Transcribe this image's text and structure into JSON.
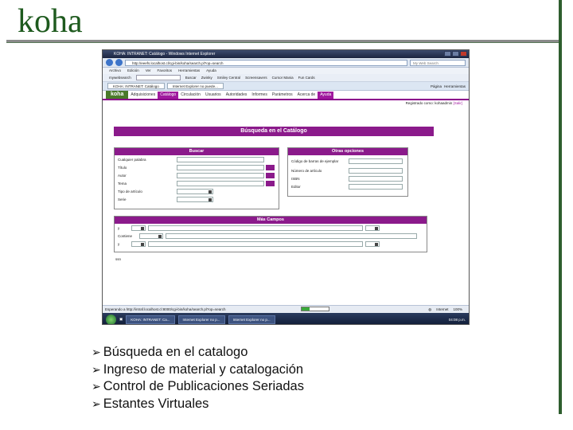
{
  "slide": {
    "title": "koha",
    "bullets": [
      "Búsqueda en el catalogo",
      "Ingreso de material y catalogación",
      "Control de Publicaciones Seriadas",
      "Estantes Virtuales"
    ]
  },
  "browser": {
    "window_title": "KOHA: INTRANET: Catálogo - Windows Internet Explorer",
    "address": "http://eeefs.localhost.cl/cgi-bin/koha/search.pl?op=search",
    "search_placeholder": "My Web Search",
    "menu": [
      "Archivo",
      "Edición",
      "Ver",
      "Favoritos",
      "Herramientas",
      "Ayuda"
    ],
    "toolbar": [
      "mywebsearch",
      "Buscar",
      "Zwinky",
      "Smiley Central",
      "Screensavers",
      "Cursor Mania",
      "Fun Cards"
    ],
    "page_tabs": [
      "KOHA: INTRANET: Catálogo",
      "Internet Explorer no puede..."
    ],
    "toolbar_right": [
      "Página",
      "Herramientas"
    ]
  },
  "koha": {
    "logo": "koha",
    "nav": [
      "Adquisiciones",
      "Catálogo",
      "Circulación",
      "Usuarios",
      "Autoridades",
      "Informes",
      "Parámetros",
      "Acerca de",
      "Ayuda"
    ],
    "active_nav": "Catálogo",
    "user_line_prefix": "Registrado como:",
    "user_name": "kohaadmin",
    "logout": "[Salir]",
    "main_heading": "Búsqueda en el Catálogo",
    "buscar_panel": {
      "title": "Buscar",
      "fields": [
        "Cualquier palabra",
        "Título",
        "Autor",
        "Tema",
        "Tipo de artículo",
        "Serie"
      ]
    },
    "otras_panel": {
      "title": "Otras opciones",
      "fields": [
        "Código de barras de ejemplar",
        "Número de artículo",
        "ISBN",
        "Editor"
      ]
    },
    "mas_campos": {
      "title": "Más Campos",
      "rows": [
        {
          "op": "y",
          "sel": ""
        },
        {
          "op": "Contiene",
          "sel": ""
        },
        {
          "op": "y",
          "sel": ""
        }
      ]
    },
    "footer_label": "ssn"
  },
  "status": {
    "text": "Esperando a http://intraf.localhost.cl:8000/cgi-bin/koha/search.pl?op=search",
    "zone": "Internet",
    "zoom": "100%",
    "progress": 0.3
  },
  "taskbar": {
    "items": [
      "KOHA: INTRANET: Ca...",
      "Internet Explorer no p...",
      "Internet Explorer no p..."
    ],
    "clock": "04:08 p.m."
  }
}
